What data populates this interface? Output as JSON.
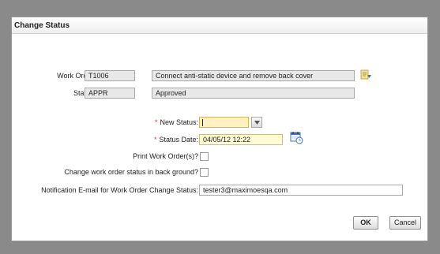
{
  "dialog": {
    "title": "Change Status",
    "work_order": {
      "label": "Work Order:",
      "value": "T1006",
      "description": "Connect anti-static device and remove back cover"
    },
    "status": {
      "label": "Status:",
      "value": "APPR",
      "description": "Approved"
    },
    "new_status": {
      "label": "New Status:",
      "value": ""
    },
    "status_date": {
      "label": "Status Date:",
      "value": "04/05/12 12:22"
    },
    "print_work_orders": {
      "label": "Print Work Order(s)?",
      "checked": false
    },
    "change_in_background": {
      "label": "Change work order status in back ground?",
      "checked": false
    },
    "notification_email": {
      "label": "Notification E-mail for Work Order Change Status:",
      "value": "tester3@maximoesqa.com"
    },
    "ok_label": "OK",
    "cancel_label": "Cancel"
  },
  "colors": {
    "required_marker": "#d23a3a",
    "active_field": "#fff1c2",
    "date_field": "#fffbd6"
  },
  "icons": {
    "work_order_detail": "detail-menu-icon",
    "status_date_picker": "calendar-icon",
    "new_status_dropdown": "chevron-down-icon"
  }
}
